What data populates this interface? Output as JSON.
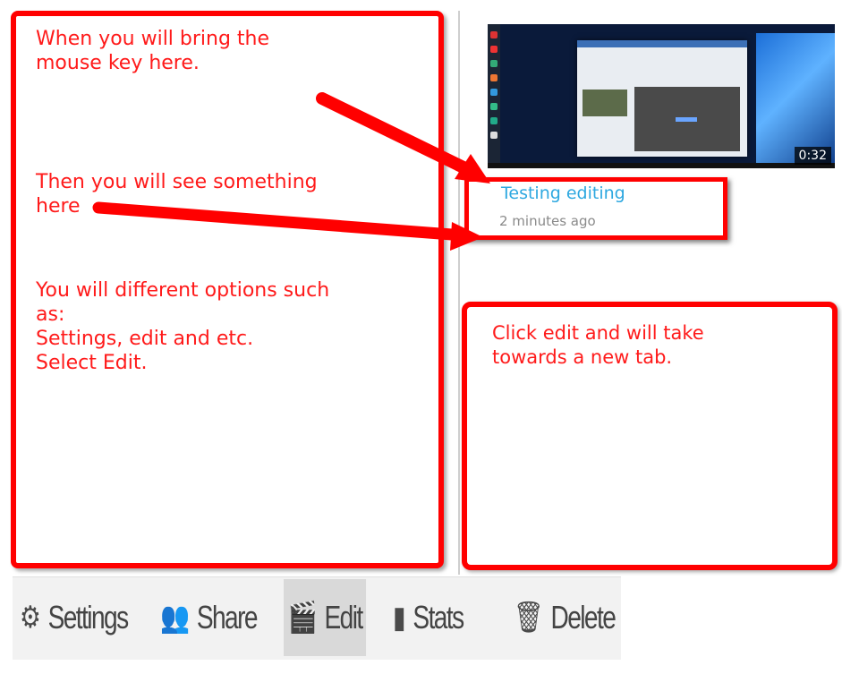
{
  "annotations": {
    "left_note_1": "When you will bring the\nmouse key here.",
    "left_note_2": "Then you will see something\nhere",
    "left_note_3": "You will different options such\nas:\nSettings, edit and etc.\nSelect Edit.",
    "right_note": "Click edit and will take\ntowards a new tab."
  },
  "video": {
    "duration": "0:32",
    "title": "Testing editing",
    "time_ago": "2 minutes ago"
  },
  "toolbar": {
    "settings_label": "Settings",
    "share_label": "Share",
    "edit_label": "Edit",
    "stats_label": "Stats",
    "delete_label": "Delete",
    "icons": [
      "gear-icon",
      "users-icon",
      "edit-icon",
      "stats-icon",
      "trash-icon"
    ]
  },
  "colors": {
    "annotation_red": "#ff0000",
    "title_blue": "#2ea8e0",
    "toolbar_bg": "#f2f2f2"
  }
}
